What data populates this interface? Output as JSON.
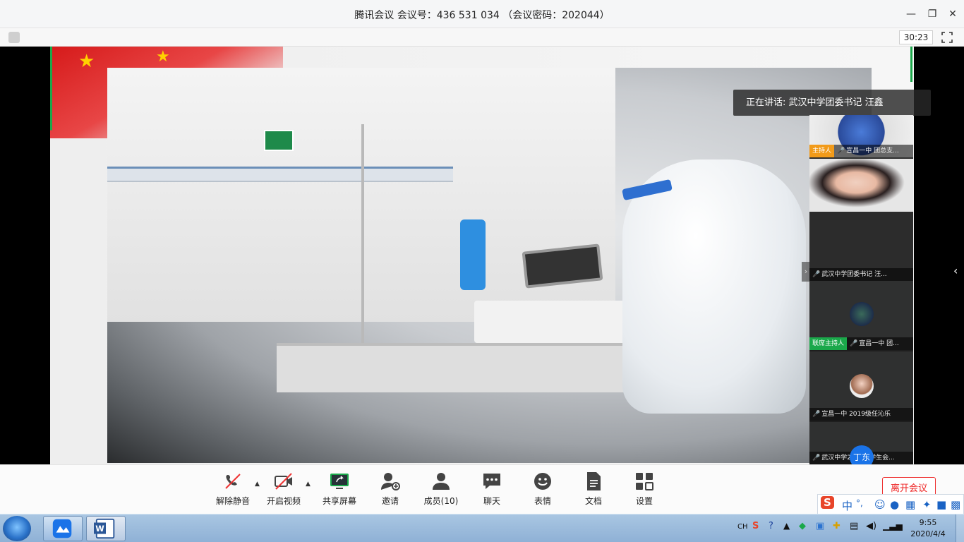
{
  "window": {
    "title": "腾讯会议 会议号：436 531 034 （会议密码：202044）",
    "timer": "30:23"
  },
  "speaking": {
    "text": "正在讲话: 武汉中学团委书记  汪鑫"
  },
  "participants": [
    {
      "role": "主持人",
      "name": "宣昌一中 团总支...",
      "role_color": "#f29b1a"
    },
    {
      "role": "",
      "name": "武汉中学团委书记  汪..."
    },
    {
      "role": "联席主持人",
      "name": "宣昌一中 团...",
      "role_color": "#1aa84a"
    },
    {
      "role": "",
      "name": "宣昌一中 2019级任沁乐"
    },
    {
      "role": "",
      "name": "武汉中学2018级学生会...",
      "avatar_text": "丁东"
    }
  ],
  "toolbar": {
    "mute_label": "解除静音",
    "video_label": "开启视频",
    "share_label": "共享屏幕",
    "invite_label": "邀请",
    "members_label": "成员(10)",
    "chat_label": "聊天",
    "emoji_label": "表情",
    "docs_label": "文档",
    "settings_label": "设置",
    "leave_label": "离开会议"
  },
  "ime": {
    "lang": "中",
    "punct": "°,"
  },
  "taskbar": {
    "lang": "CH",
    "time": "9:55",
    "date": "2020/4/4"
  },
  "colors": {
    "accent_blue": "#1a73e8",
    "leave_red": "#e22222",
    "share_green": "#1aa84a"
  }
}
